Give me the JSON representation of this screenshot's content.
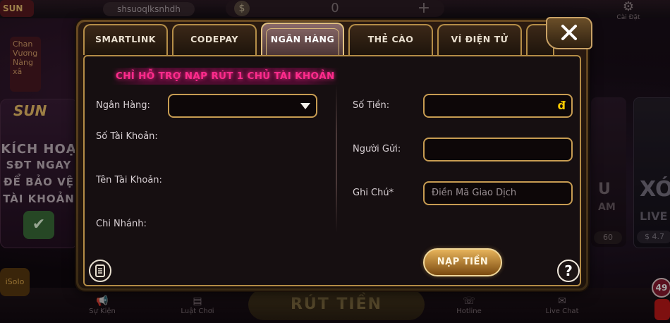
{
  "background": {
    "logo": "SUN",
    "username": "shsuoqlksnhdh",
    "balance": "0",
    "settings_label": "Cài Đặt",
    "left_thumb_text": "Chan Vương Nàng xâ",
    "left_card": {
      "brand": "SUN",
      "lines": [
        "KÍCH HOẠ",
        "SĐT NGAY",
        "ĐỂ BẢO VỆ",
        "TÀI KHOẢN"
      ]
    },
    "right_card_1": {
      "big": "U",
      "small": "AM",
      "pill": "60"
    },
    "right_card_2": {
      "big": "XÓ",
      "small": "LIVE",
      "pill": "$ 4.7"
    },
    "bottom_nav": [
      "Sự Kiện",
      "Luật Chơi",
      "Hotline",
      "Live Chat"
    ],
    "center_button": "RÚT TIỀN",
    "side_icon": "iSoIo",
    "notification_count": "49"
  },
  "modal": {
    "tabs": [
      {
        "label": "SMARTLINK",
        "active": false
      },
      {
        "label": "CODEPAY",
        "active": false
      },
      {
        "label": "NGÂN HÀNG",
        "active": true
      },
      {
        "label": "THẺ CÀO",
        "active": false
      },
      {
        "label": "VÍ ĐIỆN TỬ",
        "active": false
      }
    ],
    "notice": "CHỈ HỖ TRỢ NẠP RÚT 1 CHỦ TÀI KHOẢN",
    "left": {
      "bank_label": "Ngân Hàng:",
      "bank_value": "",
      "account_number_label": "Số Tài Khoản:",
      "account_name_label": "Tên Tài Khoản:",
      "branch_label": "Chi Nhánh:"
    },
    "right": {
      "amount_label": "Số Tiền:",
      "amount_value": "",
      "currency": "đ",
      "sender_label": "Người Gửi:",
      "sender_value": "",
      "note_label": "Ghi Chú*",
      "note_placeholder": "Điền Mã Giao Dịch"
    },
    "submit_label": "NẠP TIỀN",
    "help_label": "?"
  }
}
